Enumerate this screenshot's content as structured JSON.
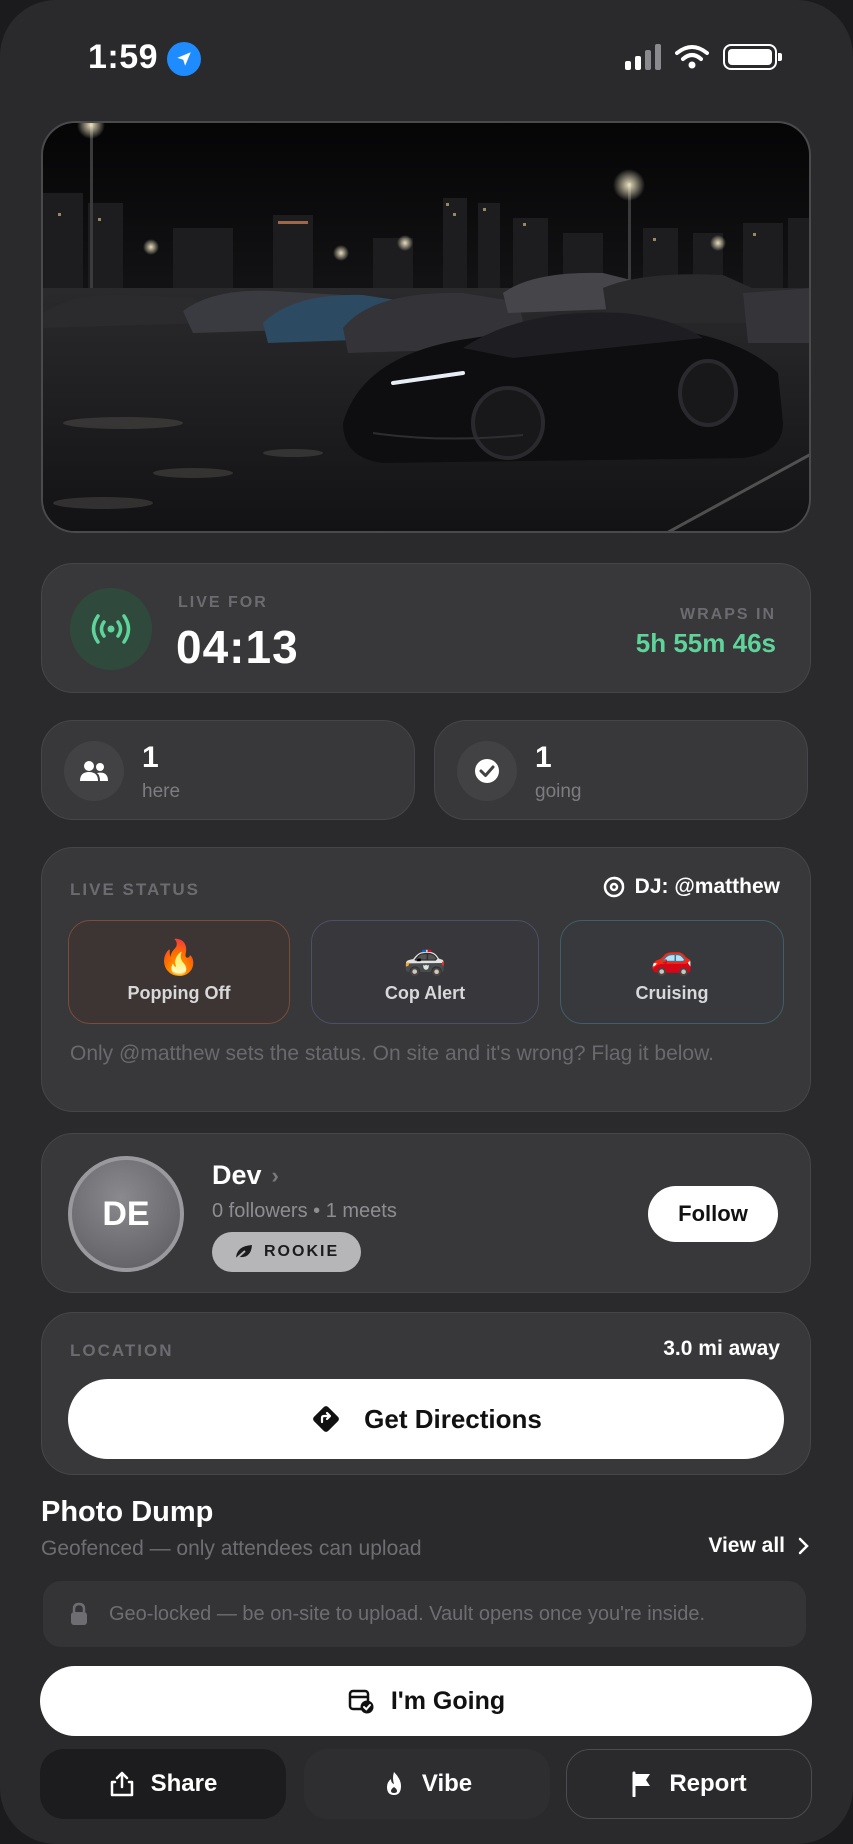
{
  "status_bar": {
    "time": "1:59",
    "icons": [
      "location-arrow-icon",
      "signal-icon",
      "wifi-icon",
      "battery-icon"
    ]
  },
  "hero": {
    "icon": "night-car-meet-photo"
  },
  "live": {
    "label": "LIVE FOR",
    "elapsed": "04:13",
    "wraps_label": "WRAPS IN",
    "wraps_value": "5h 55m 46s",
    "accent_color": "#5fd49a",
    "icon": "broadcast-icon"
  },
  "stats": [
    {
      "count": "1",
      "label": "here",
      "icon": "people-icon"
    },
    {
      "count": "1",
      "label": "going",
      "icon": "check-circle-icon"
    }
  ],
  "live_status": {
    "label": "LIVE STATUS",
    "dj": "DJ: @matthew",
    "options": [
      {
        "emoji": "🔥",
        "label": "Popping Off"
      },
      {
        "emoji": "🚓",
        "label": "Cop Alert"
      },
      {
        "emoji": "🚗",
        "label": "Cruising"
      }
    ],
    "note": "Only @matthew sets the status. On site and it's wrong? Flag it below."
  },
  "host": {
    "initials": "DE",
    "name": "Dev",
    "meta": "0 followers • 1 meets",
    "badge": "ROOKIE",
    "follow_label": "Follow"
  },
  "location": {
    "label": "LOCATION",
    "distance": "3.0 mi away",
    "directions_label": "Get Directions"
  },
  "photo_dump": {
    "title": "Photo Dump",
    "subtitle": "Geofenced — only attendees can upload",
    "view_all": "View all",
    "notice": "Geo-locked — be on-site to upload. Vault opens once you're inside."
  },
  "actions": {
    "going": "I'm Going",
    "share": "Share",
    "vibe": "Vibe",
    "report": "Report"
  }
}
